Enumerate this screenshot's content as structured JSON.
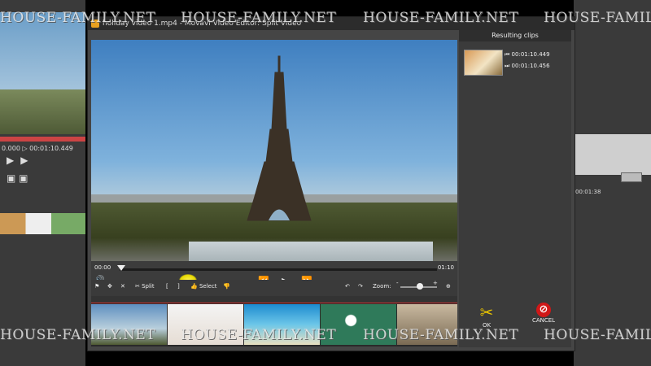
{
  "window": {
    "title": "holiday video 1.mp4 - Movavi Video Editor: Split Video"
  },
  "watermark": {
    "text": "HOUSE-FAMILY.NET"
  },
  "background_app": {
    "left_time": "0.000  ▷ 00:01:10.449",
    "right_time": "00:01:38"
  },
  "player": {
    "time_start": "00:00",
    "time_end": "01:10",
    "volume_icon": "speaker-icon",
    "controls": {
      "prev": "⏪",
      "play": "▶",
      "next": "⏩"
    }
  },
  "toolbar": {
    "split_label": "Split",
    "select_label": "Select",
    "zoom_label": "Zoom:",
    "zoom_minus": "-",
    "zoom_plus": "+",
    "zoom_level": 0.55
  },
  "side_panel": {
    "header": "Resulting clips",
    "clips": [
      {
        "time": "00:01:10.449"
      },
      {
        "time": "00:01:10.456"
      }
    ],
    "ok_label": "OK",
    "cancel_label": "CANCEL"
  },
  "colors": {
    "accent": "#e8c300",
    "cancel": "#d01818",
    "timeline_marker": "#cc3333"
  }
}
